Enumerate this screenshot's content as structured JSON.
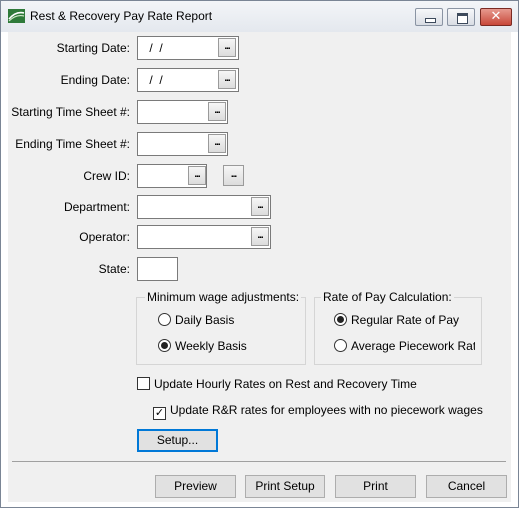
{
  "window": {
    "title": "Rest & Recovery Pay Rate Report"
  },
  "titlebar": {
    "close_glyph": "✕"
  },
  "fields": {
    "starting_date": {
      "label": "Starting Date:",
      "value": " /  /"
    },
    "ending_date": {
      "label": "Ending Date:",
      "value": " /  /"
    },
    "starting_timesheet": {
      "label": "Starting Time Sheet #:",
      "value": ""
    },
    "ending_timesheet": {
      "label": "Ending Time Sheet #:",
      "value": ""
    },
    "crew_id": {
      "label": "Crew ID:",
      "value": ""
    },
    "department": {
      "label": "Department:",
      "value": ""
    },
    "operator": {
      "label": "Operator:",
      "value": ""
    },
    "state": {
      "label": "State:",
      "value": ""
    }
  },
  "ellipsis": "...",
  "min_wage_group": {
    "title": "Minimum wage adjustments:",
    "options": [
      {
        "label": "Daily Basis",
        "selected": false
      },
      {
        "label": "Weekly Basis",
        "selected": true
      }
    ]
  },
  "rate_group": {
    "title": "Rate of Pay Calculation:",
    "options": [
      {
        "label": "Regular Rate of Pay",
        "selected": true
      },
      {
        "label": "Average Piecework Rate",
        "selected": false
      }
    ]
  },
  "checks": {
    "update_hourly": {
      "label": "Update Hourly Rates on Rest and Recovery Time",
      "checked": false
    },
    "update_rr": {
      "label": "Update R&R rates for employees with no piecework wages",
      "checked": true
    }
  },
  "buttons": {
    "setup": "Setup...",
    "preview": "Preview",
    "print_setup": "Print Setup",
    "print": "Print",
    "cancel": "Cancel"
  },
  "colors": {
    "focus_border": "#0078d7",
    "close_button": "#c8483a"
  }
}
